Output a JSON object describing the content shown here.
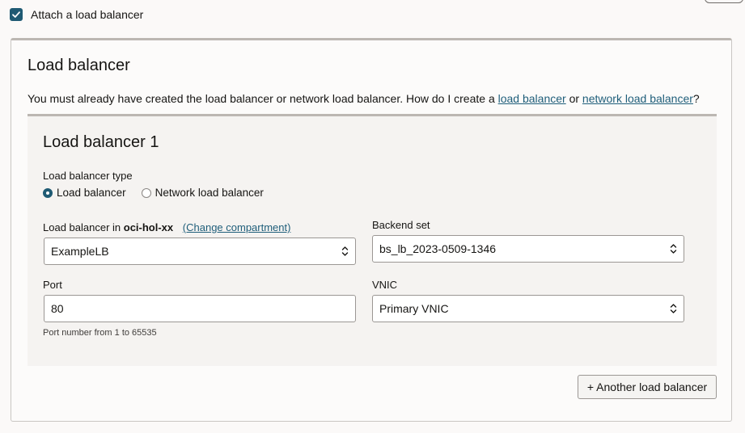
{
  "attach": {
    "label": "Attach a load balancer",
    "checked": true
  },
  "panel": {
    "title": "Load balancer",
    "desc_prefix": "You must already have created the load balancer or network load balancer. How do I create a ",
    "link_lb": "load balancer",
    "desc_or": " or ",
    "link_nlb": "network load balancer",
    "desc_suffix": "?"
  },
  "card": {
    "title": "Load balancer 1",
    "type_label": "Load balancer type",
    "type_options": [
      {
        "label": "Load balancer",
        "selected": true
      },
      {
        "label": "Network load balancer",
        "selected": false
      }
    ],
    "lb_in_label": "Load balancer in ",
    "compartment": "oci-hol-xx",
    "change_compartment": "(Change compartment)",
    "lb_value": "ExampleLB",
    "backend_label": "Backend set",
    "backend_value": "bs_lb_2023-0509-1346",
    "port_label": "Port",
    "port_value": "80",
    "port_help": "Port number from 1 to 65535",
    "vnic_label": "VNIC",
    "vnic_value": "Primary VNIC"
  },
  "add_button": "+ Another load balancer",
  "colors": {
    "accent": "#1f5a73",
    "link": "#1f5e7a",
    "background": "#fbf9f8",
    "card": "#f5f3f1"
  }
}
